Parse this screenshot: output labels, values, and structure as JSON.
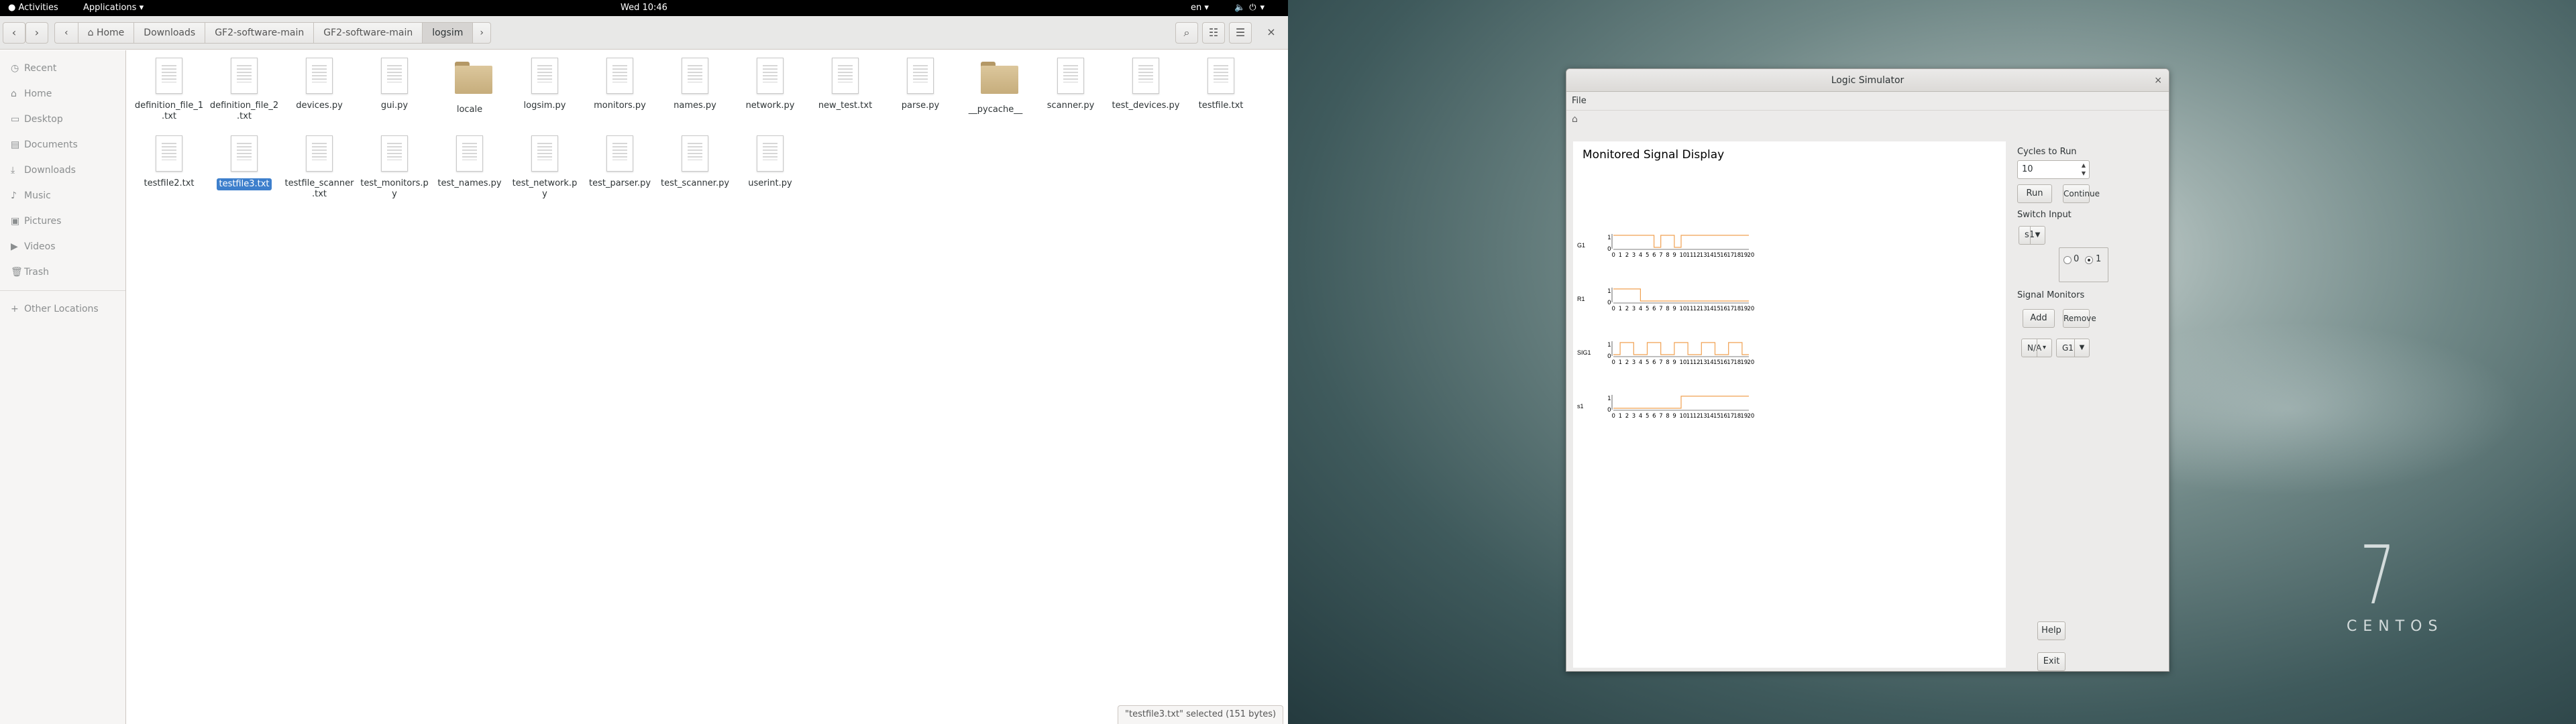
{
  "topbar": {
    "activities": "Activities",
    "applications": "Applications",
    "clock": "Wed 10:46",
    "lang": "en"
  },
  "files": {
    "breadcrumbs": [
      "Home",
      "Downloads",
      "GF2-software-main",
      "GF2-software-main",
      "logsim"
    ],
    "sidebar": [
      {
        "label": "Recent",
        "icon": "clock-icon"
      },
      {
        "label": "Home",
        "icon": "home-icon"
      },
      {
        "label": "Desktop",
        "icon": "desktop-icon"
      },
      {
        "label": "Documents",
        "icon": "document-icon"
      },
      {
        "label": "Downloads",
        "icon": "download-icon"
      },
      {
        "label": "Music",
        "icon": "music-icon"
      },
      {
        "label": "Pictures",
        "icon": "picture-icon"
      },
      {
        "label": "Videos",
        "icon": "video-icon"
      },
      {
        "label": "Trash",
        "icon": "trash-icon"
      },
      {
        "label": "Other Locations",
        "icon": "plus-icon"
      }
    ],
    "rows": [
      [
        {
          "name": "definition_file_1.txt",
          "type": "doc"
        },
        {
          "name": "definition_file_2.txt",
          "type": "doc"
        },
        {
          "name": "devices.py",
          "type": "doc"
        },
        {
          "name": "gui.py",
          "type": "doc"
        },
        {
          "name": "locale",
          "type": "folder"
        },
        {
          "name": "logsim.py",
          "type": "doc"
        },
        {
          "name": "monitors.py",
          "type": "doc"
        },
        {
          "name": "names.py",
          "type": "doc"
        },
        {
          "name": "network.py",
          "type": "doc"
        },
        {
          "name": "new_test.txt",
          "type": "doc"
        },
        {
          "name": "parse.py",
          "type": "doc"
        },
        {
          "name": "__pycache__",
          "type": "folder"
        },
        {
          "name": "scanner.py",
          "type": "doc"
        },
        {
          "name": "test_devices.py",
          "type": "doc"
        },
        {
          "name": "testfile.txt",
          "type": "doc"
        }
      ],
      [
        {
          "name": "testfile2.txt",
          "type": "doc"
        },
        {
          "name": "testfile3.txt",
          "type": "doc",
          "selected": true
        },
        {
          "name": "testfile_scanner.txt",
          "type": "doc"
        },
        {
          "name": "test_monitors.py",
          "type": "doc"
        },
        {
          "name": "test_names.py",
          "type": "doc"
        },
        {
          "name": "test_network.py",
          "type": "doc"
        },
        {
          "name": "test_parser.py",
          "type": "doc"
        },
        {
          "name": "test_scanner.py",
          "type": "doc"
        },
        {
          "name": "userint.py",
          "type": "doc"
        }
      ]
    ],
    "status": "\"testfile3.txt\" selected (151 bytes)"
  },
  "desktop": {
    "brand_number": "7",
    "brand_text": "CENTOS"
  },
  "simulator": {
    "title": "Logic Simulator",
    "menu_file": "File",
    "display_title": "Monitored Signal Display",
    "cycles_label": "Cycles to Run",
    "cycles_value": "10",
    "run_label": "Run",
    "continue_label": "Continue",
    "switch_label": "Switch Input",
    "switch_selected": "s1",
    "radio_0": "0",
    "radio_1": "1",
    "radio_selected": 1,
    "monitors_label": "Signal Monitors",
    "add_label": "Add",
    "remove_label": "Remove",
    "monitor_select_left": "N/A",
    "monitor_select_right": "G1",
    "help_label": "Help",
    "exit_label": "Exit",
    "trace_color": "#f0a050"
  },
  "chart_data": {
    "type": "line",
    "title": "Monitored Signal Display",
    "x": [
      0,
      1,
      2,
      3,
      4,
      5,
      6,
      7,
      8,
      9,
      10,
      11,
      12,
      13,
      14,
      15,
      16,
      17,
      18,
      19,
      20
    ],
    "ylim": [
      0,
      1
    ],
    "series": [
      {
        "name": "G1",
        "values": [
          1,
          1,
          1,
          1,
          1,
          1,
          0,
          1,
          1,
          0,
          1,
          1,
          1,
          1,
          1,
          1,
          1,
          1,
          1,
          1
        ]
      },
      {
        "name": "R1",
        "values": [
          1,
          1,
          1,
          1,
          0,
          0,
          0,
          0,
          0,
          0,
          0,
          0,
          0,
          0,
          0,
          0,
          0,
          0,
          0,
          0
        ]
      },
      {
        "name": "SIG1",
        "values": [
          0,
          1,
          1,
          0,
          0,
          1,
          1,
          0,
          0,
          1,
          1,
          0,
          0,
          1,
          1,
          0,
          0,
          1,
          1,
          0,
          0,
          1,
          1,
          0,
          1,
          1
        ]
      },
      {
        "name": "s1",
        "values": [
          0,
          0,
          0,
          0,
          0,
          0,
          0,
          0,
          0,
          0,
          1,
          1,
          1,
          1,
          1,
          1,
          1,
          1,
          1,
          1
        ]
      }
    ]
  }
}
